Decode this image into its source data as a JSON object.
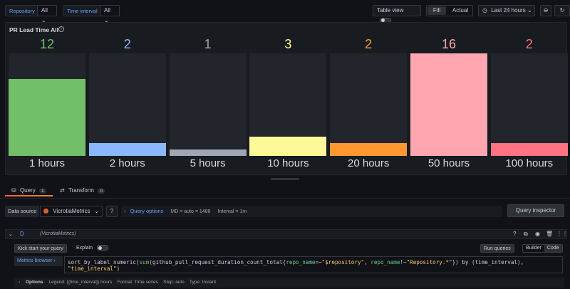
{
  "toolbar": {
    "repository_label": "Repository",
    "repository_value": "All",
    "interval_label": "Time interval",
    "interval_value": "All",
    "table_view_label": "Table view",
    "fill_label": "Fill",
    "actual_label": "Actual",
    "time_range": "Last 24 hours"
  },
  "panel": {
    "title": "PR Lead Time All",
    "max_value": 16,
    "bars": [
      {
        "value": 12,
        "label": "1 hours",
        "color": "#73bf69"
      },
      {
        "value": 2,
        "label": "2 hours",
        "color": "#8ab8ff"
      },
      {
        "value": 1,
        "label": "5 hours",
        "color": "#9fa7b3"
      },
      {
        "value": 3,
        "label": "10 hours",
        "color": "#fff899"
      },
      {
        "value": 2,
        "label": "20 hours",
        "color": "#ff9830"
      },
      {
        "value": 16,
        "label": "50 hours",
        "color": "#ffa6b0"
      },
      {
        "value": 2,
        "label": "100 hours",
        "color": "#ff7383"
      }
    ]
  },
  "tabs": {
    "query_label": "Query",
    "query_count": "1",
    "transform_label": "Transform",
    "transform_count": "0"
  },
  "datasource": {
    "label": "Data source",
    "value": "VicrotiaMetrics",
    "query_options": "Query options",
    "md": "MD = auto = 1488",
    "interval": "Interval = 1m",
    "inspector": "Query inspector"
  },
  "query": {
    "ref": "D",
    "ds_name": "(VicrotiaMetrics)",
    "kick_start": "Kick start your query",
    "explain": "Explain",
    "run": "Run queries",
    "builder": "Builder",
    "code": "Code",
    "metrics_browser": "Metrics browser ›",
    "line1_pre": "sort_by_label_numeric(",
    "line1_fn": "sum",
    "line1_mid": "(github_pull_request_duration_count_total{",
    "line1_l1": "repo_name",
    "line1_op1": "=~",
    "line1_v1": "\"$repository\"",
    "line1_sep": ", ",
    "line1_l2": "repo_name",
    "line1_op2": "!~",
    "line1_v2": "\"Repository.*\"",
    "line1_end": "}) by (time_interval),",
    "line2": "\"time_interval\")",
    "options_label": "Options",
    "options_detail": "Legend: {{time_interval}} hours    Format: Time series    Step: auto    Type: Instant"
  }
}
